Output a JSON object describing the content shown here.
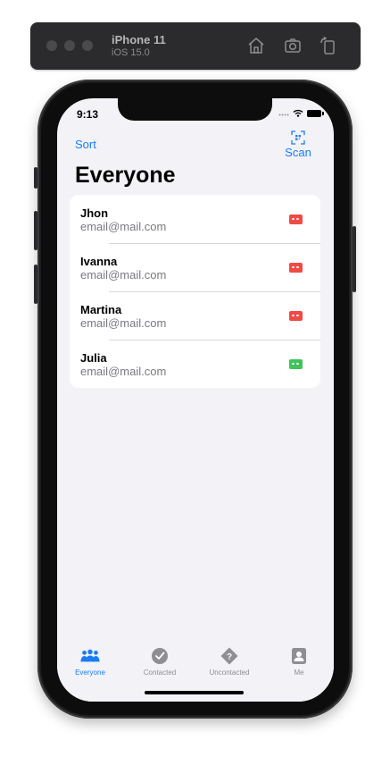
{
  "simulator": {
    "device": "iPhone 11",
    "os": "iOS 15.0",
    "icons": [
      "home-icon",
      "screenshot-icon",
      "rotate-icon"
    ]
  },
  "status_bar": {
    "time": "9:13"
  },
  "nav": {
    "left_label": "Sort",
    "right_label": "Scan",
    "right_icon": "qr-scan-icon"
  },
  "title": "Everyone",
  "contacts": [
    {
      "name": "Jhon",
      "email": "email@mail.com",
      "status_color": "#f04a45"
    },
    {
      "name": "Ivanna",
      "email": "email@mail.com",
      "status_color": "#f04a45"
    },
    {
      "name": "Martina",
      "email": "email@mail.com",
      "status_color": "#f04a45"
    },
    {
      "name": "Julia",
      "email": "email@mail.com",
      "status_color": "#3fc35a"
    }
  ],
  "tabs": [
    {
      "label": "Everyone",
      "icon": "people-icon",
      "active": true
    },
    {
      "label": "Contacted",
      "icon": "checkmark-circle-icon",
      "active": false
    },
    {
      "label": "Uncontacted",
      "icon": "question-diamond-icon",
      "active": false
    },
    {
      "label": "Me",
      "icon": "person-square-icon",
      "active": false
    }
  ],
  "colors": {
    "accent": "#1a7cf5",
    "background": "#f2f2f7",
    "inactive_tab": "#8e8e93"
  }
}
